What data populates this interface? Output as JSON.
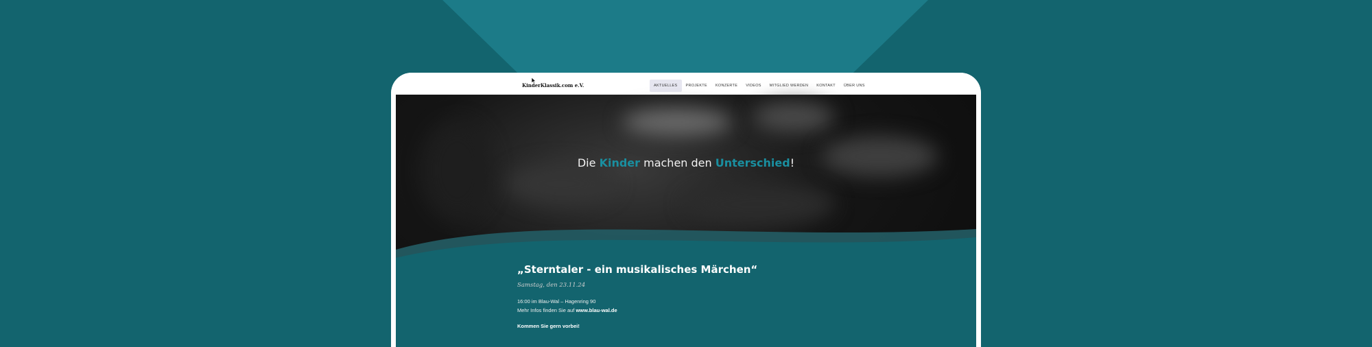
{
  "colors": {
    "page_background": "#13646e",
    "accent_teal": "#1a8fa0",
    "content_background": "#13646e"
  },
  "header": {
    "logo_text": "KinderKlassik.com e.V.",
    "nav": [
      {
        "label": "AKTUELLES",
        "active": true
      },
      {
        "label": "PROJEKTE",
        "active": false
      },
      {
        "label": "KONZERTE",
        "active": false
      },
      {
        "label": "VIDEOS",
        "active": false
      },
      {
        "label": "MITGLIED WERDEN",
        "active": false
      },
      {
        "label": "KONTAKT",
        "active": false
      },
      {
        "label": "ÜBER UNS",
        "active": false
      }
    ]
  },
  "hero": {
    "part1": "Die ",
    "highlight1": "Kinder",
    "part2": " machen den ",
    "highlight2": "Unterschied",
    "part3": "!"
  },
  "event": {
    "title": "„Sterntaler - ein musikalisches Märchen“",
    "date": "Samstag, den 23.11.24",
    "line1": "16:00 im Blau-Wal – Hagenring 90",
    "line2_prefix": "Mehr Infos finden Sie auf ",
    "line2_link": "www.blau-wal.de",
    "cta": "Kommen Sie gern vorbei!"
  }
}
